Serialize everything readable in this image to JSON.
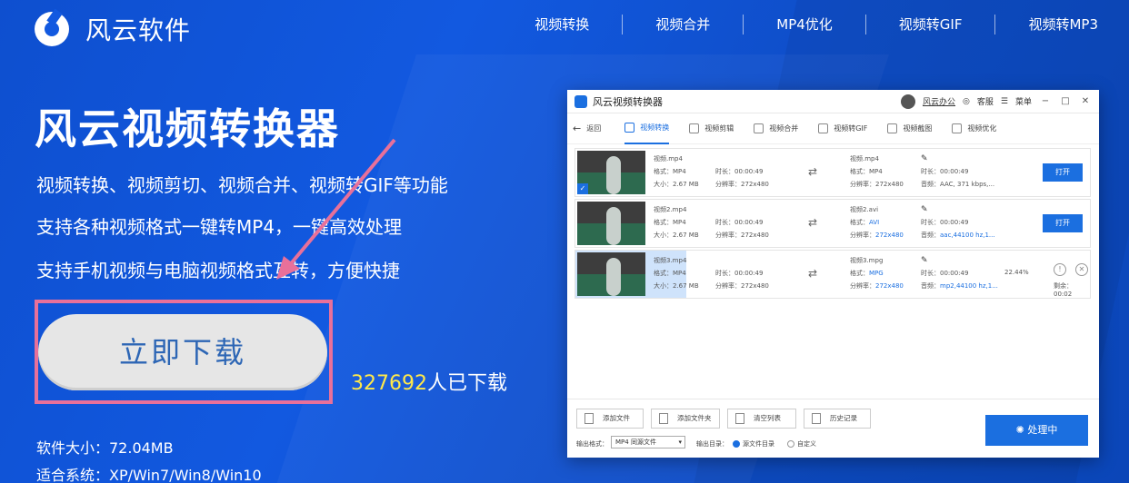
{
  "brand": {
    "name": "风云软件"
  },
  "nav": [
    "视频转换",
    "视频合并",
    "MP4优化",
    "视频转GIF",
    "视频转MP3"
  ],
  "hero": {
    "title": "风云视频转换器",
    "features": [
      "视频转换、视频剪切、视频合并、视频转GIF等功能",
      "支持各种视频格式一键转MP4，一键高效处理",
      "支持手机视频与电脑视频格式互转，方便快捷"
    ],
    "download_label": "立即下载",
    "download_count": "327692",
    "download_suffix": "人已下载",
    "size": "软件大小：72.04MB",
    "system": "适合系统：XP/Win7/Win8/Win10"
  },
  "colors": {
    "accent": "#1259e0",
    "highlight": "#ffe94a",
    "frame": "#e8709a",
    "app_blue": "#1b6fe0"
  },
  "app": {
    "title": "风云视频转换器",
    "user": "风云办公",
    "service": "客服",
    "menu": "菜单",
    "win_min": "−",
    "win_max": "□",
    "win_close": "✕",
    "back": "返回",
    "tools": [
      "视频转换",
      "视频剪辑",
      "视频合并",
      "视频转GIF",
      "视频截图",
      "视频优化"
    ],
    "files": [
      {
        "name": "视频.mp4",
        "format": "格式：MP4",
        "size": "大小：2.67 MB",
        "duration": "时长：00:00:49",
        "resolution": "分辨率：272x480",
        "out_name": "视频.mp4",
        "out_format": "格式：MP4",
        "out_res": "分辨率：272x480",
        "out_duration": "时长：00:00:49",
        "audio": "音频：AAC, 371 kbps,...",
        "action": "打开"
      },
      {
        "name": "视频2.mp4",
        "format": "格式：MP4",
        "size": "大小：2.67 MB",
        "duration": "时长：00:00:49",
        "resolution": "分辨率：272x480",
        "out_name": "视频2.avi",
        "out_format_label": "格式：",
        "out_format_val": "AVI",
        "out_res_label": "分辨率：",
        "out_res_val": "272x480",
        "out_duration": "时长：00:00:49",
        "audio_label": "音频：",
        "audio_val": "aac,44100 hz,1...",
        "action": "打开"
      },
      {
        "name": "视频3.mp4",
        "format": "格式：MP4",
        "size": "大小：2.67 MB",
        "duration": "时长：00:00:49",
        "resolution": "分辨率：272x480",
        "out_name": "视频3.mpg",
        "out_format_label": "格式：",
        "out_format_val": "MPG",
        "out_res_label": "分辨率：",
        "out_res_val": "272x480",
        "out_duration": "时长：00:00:49",
        "audio_label": "音频：",
        "audio_val": "mp2,44100 hz,1...",
        "progress": "22.44%",
        "remaining": "剩余：00:02"
      }
    ],
    "bottom": {
      "add_file": "添加文件",
      "add_folder": "添加文件夹",
      "clear": "清空列表",
      "history": "历史记录",
      "format_label": "输出格式：",
      "format_value": "MP4 同源文件",
      "dir_label": "输出目录：",
      "dir_source": "源文件目录",
      "dir_custom": "自定义",
      "process": "处理中"
    }
  }
}
